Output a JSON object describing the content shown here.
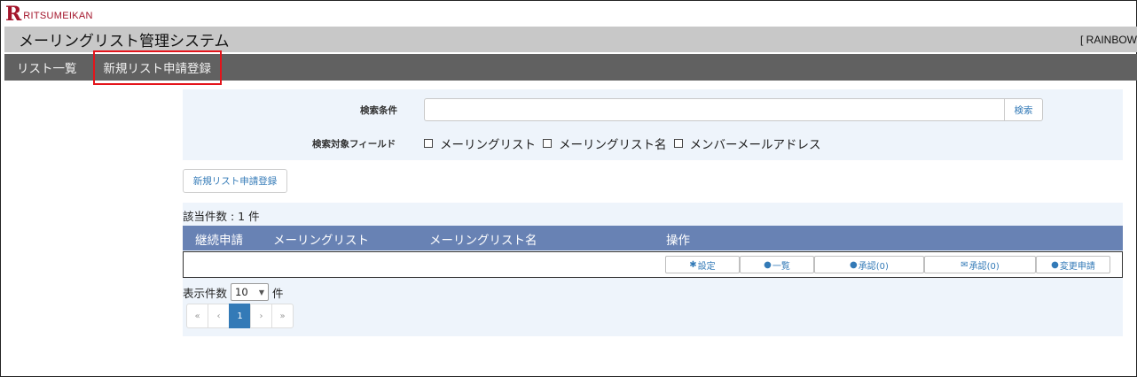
{
  "logo": {
    "mark": "R",
    "text": "RITSUMEIKAN"
  },
  "header": {
    "title": "メーリングリスト管理システム",
    "user_tag": "[ RAINBOW"
  },
  "nav": {
    "items": [
      {
        "label": "リスト一覧"
      },
      {
        "label": "新規リスト申請登録"
      }
    ]
  },
  "search": {
    "condition_label": "検索条件",
    "query_value": "",
    "button_label": "検索",
    "fields_label": "検索対象フィールド",
    "fields": [
      {
        "label": "メーリングリスト",
        "checked": false
      },
      {
        "label": "メーリングリスト名",
        "checked": false
      },
      {
        "label": "メンバーメールアドレス",
        "checked": false
      }
    ]
  },
  "new_request_button": "新規リスト申請登録",
  "results": {
    "count_text": "該当件数 : 1 件",
    "columns": [
      "継続申請",
      "メーリングリスト",
      "メーリングリスト名",
      "操作"
    ],
    "actions": [
      {
        "icon": "gear-icon",
        "glyph": "✱",
        "label": "設定"
      },
      {
        "icon": "user-icon",
        "glyph": "●",
        "label": "一覧"
      },
      {
        "icon": "user-icon",
        "glyph": "●",
        "label": "承認(0)"
      },
      {
        "icon": "envelope-icon",
        "glyph": "✉",
        "label": "承認(0)"
      },
      {
        "icon": "user-edit-icon",
        "glyph": "●",
        "label": "変更申請"
      }
    ]
  },
  "display": {
    "prefix": "表示件数",
    "value": "10",
    "suffix": "件"
  },
  "pagination": {
    "first": "«",
    "prev": "‹",
    "current": "1",
    "next": "›",
    "last": "»"
  }
}
